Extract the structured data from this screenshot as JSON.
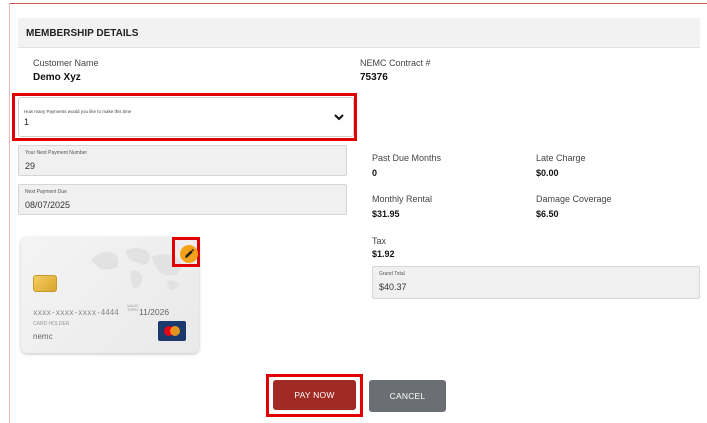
{
  "section": {
    "title": "MEMBERSHIP DETAILS"
  },
  "customer": {
    "name_label": "Customer Name",
    "name": "Demo Xyz"
  },
  "contract": {
    "label": "NEMC Contract #",
    "number": "75376"
  },
  "payments_select": {
    "label": "How many Payments would you like to make this time",
    "value": "1"
  },
  "next_payment_number": {
    "label": "Your Next Payment Number",
    "value": "29"
  },
  "next_payment_due": {
    "label": "Next Payment Due",
    "value": "08/07/2025"
  },
  "summary": {
    "past_due_months_label": "Past Due Months",
    "past_due_months": "0",
    "late_charge_label": "Late Charge",
    "late_charge": "$0.00",
    "monthly_rental_label": "Monthly Rental",
    "monthly_rental": "$31.95",
    "damage_coverage_label": "Damage Coverage",
    "damage_coverage": "$6.50",
    "tax_label": "Tax",
    "tax": "$1.92",
    "grand_total_label": "Grand Total",
    "grand_total": "$40.37"
  },
  "card": {
    "number": "xxxx-xxxx-xxxx-4444",
    "valid_label_1": "VALID",
    "valid_label_2": "THRU",
    "expiry": "11/2026",
    "holder_label": "CARD HOLDER",
    "holder_name": "nemc",
    "brand": "mastercard-icon"
  },
  "buttons": {
    "pay_now": "PAY NOW",
    "cancel": "CANCEL"
  },
  "colors": {
    "accent_red": "#e00000",
    "pay_button": "#a12a24",
    "cancel_button": "#6b6e72",
    "edit_orange": "#f5a21b"
  }
}
